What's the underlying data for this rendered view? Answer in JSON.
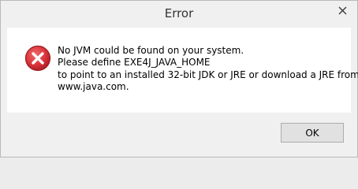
{
  "window": {
    "title": "Error"
  },
  "dialog": {
    "icon": "error-icon",
    "message_lines": [
      "No JVM could be found on your system.",
      "Please define EXE4J_JAVA_HOME",
      "to point to an installed 32-bit JDK or JRE or download a JRE from",
      "www.java.com."
    ],
    "ok_label": "OK"
  },
  "colors": {
    "error_red": "#d9343a",
    "content_bg": "#ffffff",
    "chrome_bg": "#f0f0f0"
  }
}
